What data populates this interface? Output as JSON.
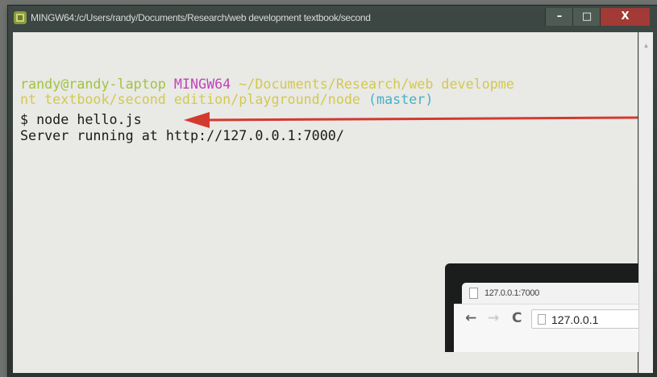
{
  "window": {
    "title": "MINGW64:/c/Users/randy/Documents/Research/web development textbook/second"
  },
  "window_controls": {
    "minimize": "–",
    "maximize": "□",
    "close": "X"
  },
  "terminal": {
    "prompt_user": "randy@randy-laptop",
    "prompt_system": "MINGW64",
    "prompt_path_line1": "~/Documents/Research/web developme",
    "prompt_path_line2": "nt textbook/second edition/playground/node",
    "prompt_branch": "(master)",
    "command_prefix": "$ ",
    "command": "node hello.js",
    "output": "Server running at http://127.0.0.1:7000/"
  },
  "annotation": {
    "arrow_color": "#d33a2f"
  },
  "browser": {
    "tab_title": "127.0.0.1:7000",
    "address": "127.0.0.1",
    "back_icon": "←",
    "forward_icon": "→",
    "reload_icon": "C"
  },
  "colors": {
    "user": "#a2c33d",
    "system": "#c044b9",
    "path": "#d3c94e",
    "branch": "#44b2c8"
  }
}
